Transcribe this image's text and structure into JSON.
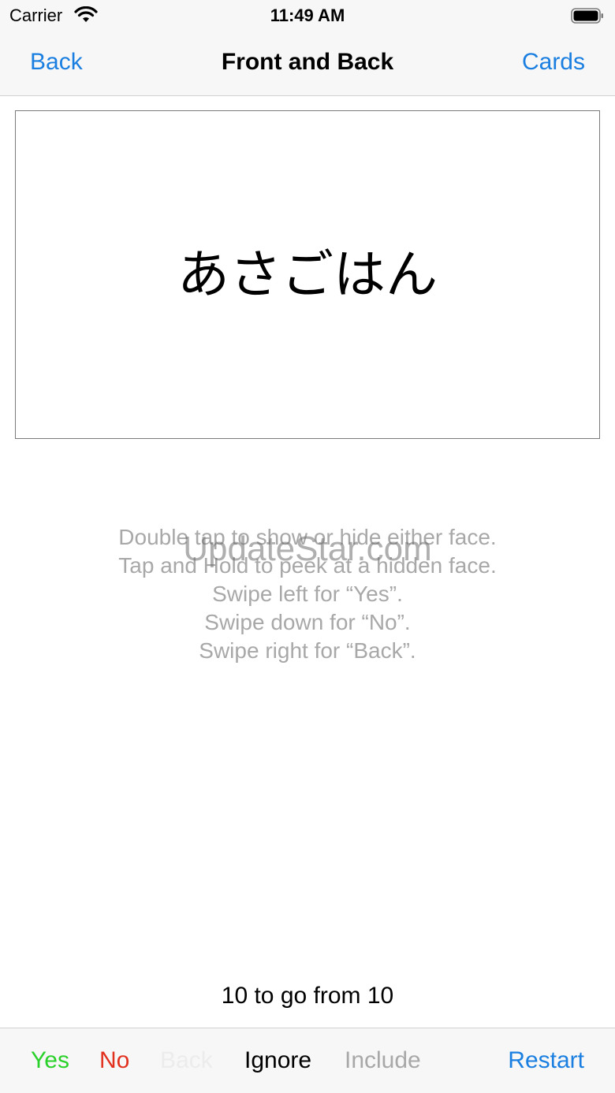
{
  "status_bar": {
    "carrier": "Carrier",
    "time": "11:49 AM"
  },
  "nav": {
    "back_label": "Back",
    "title": "Front and Back",
    "cards_label": "Cards"
  },
  "card": {
    "text": "あさごはん"
  },
  "instructions": [
    "Double tap to show or hide either face.",
    "Tap and Hold to peek at a hidden face.",
    "Swipe left for  “Yes”.",
    "Swipe down for “No”.",
    "Swipe right for “Back”."
  ],
  "watermark": "UpdateStar.com",
  "progress": "10 to go from 10",
  "toolbar": {
    "yes_label": "Yes",
    "no_label": "No",
    "back_label": "Back",
    "ignore_label": "Ignore",
    "include_label": "Include",
    "restart_label": "Restart"
  },
  "colors": {
    "accent": "#1a7fe0",
    "yes": "#2ad12a",
    "no": "#e2301e",
    "disabled": "#a8a8a8"
  }
}
